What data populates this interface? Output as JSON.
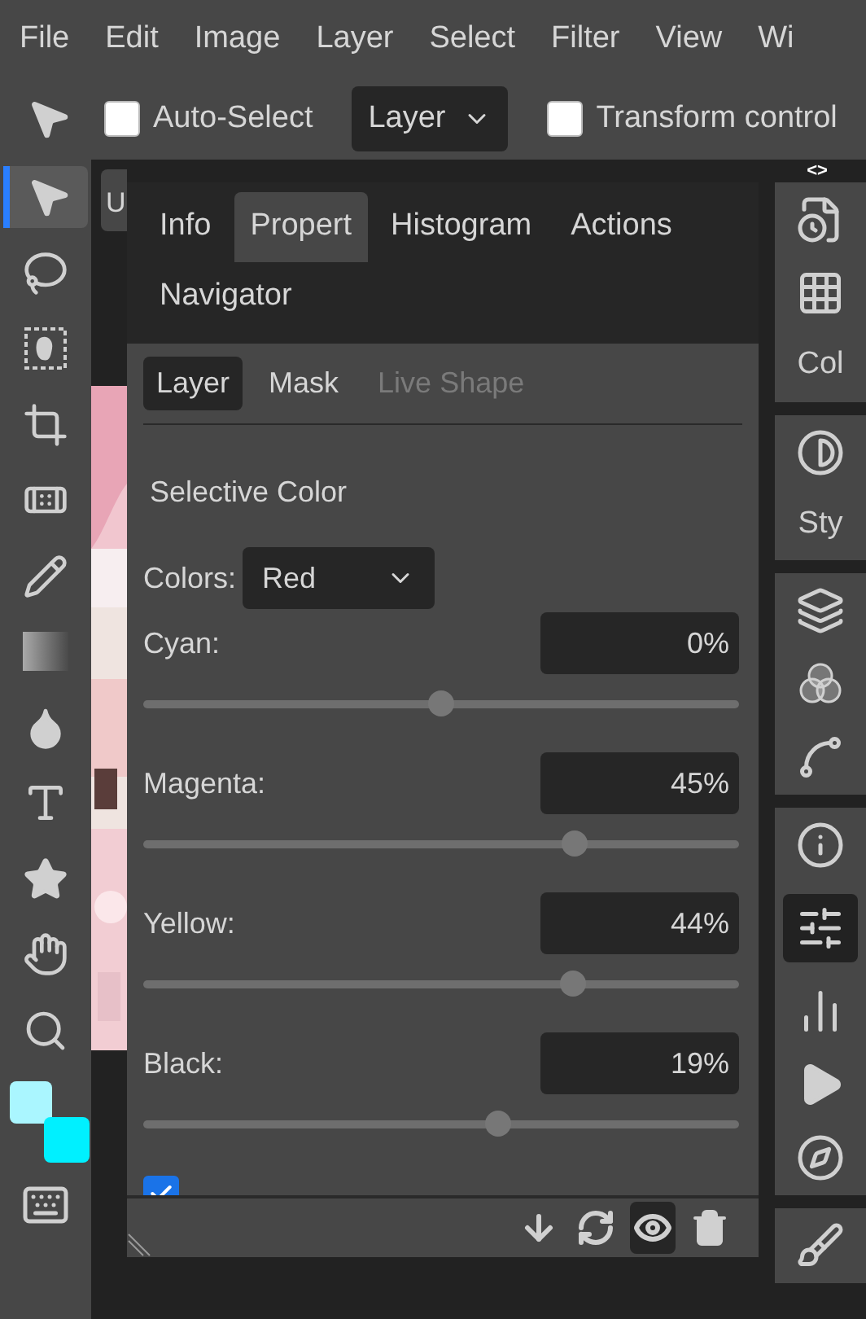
{
  "menu": [
    "File",
    "Edit",
    "Image",
    "Layer",
    "Select",
    "Filter",
    "View",
    "Wi"
  ],
  "toolbar": {
    "auto_select": {
      "label": "Auto-Select",
      "checked": false
    },
    "target": "Layer",
    "transform": {
      "label": "Transform control",
      "checked": false
    }
  },
  "tools": [
    {
      "kind": "move",
      "selected": true
    },
    {
      "kind": "lasso",
      "selected": false
    },
    {
      "kind": "quick-select",
      "selected": false
    },
    {
      "kind": "crop",
      "selected": false
    },
    {
      "kind": "heal",
      "selected": false
    },
    {
      "kind": "pencil",
      "selected": false
    },
    {
      "kind": "gradient",
      "selected": false
    },
    {
      "kind": "blur",
      "selected": false
    },
    {
      "kind": "type",
      "selected": false
    },
    {
      "kind": "shape",
      "selected": false
    },
    {
      "kind": "hand",
      "selected": false
    },
    {
      "kind": "zoom",
      "selected": false
    }
  ],
  "swatches": [
    {
      "color": "#aaf6ff"
    },
    {
      "color": "#00f0ff"
    }
  ],
  "document_tab": "U",
  "panel": {
    "tabs": [
      {
        "label": "Info",
        "selected": false
      },
      {
        "label": "Propert",
        "selected": true
      },
      {
        "label": "Histogram",
        "selected": false
      },
      {
        "label": "Actions",
        "selected": false
      },
      {
        "label": "Navigator",
        "selected": false
      }
    ],
    "sub_tabs": [
      {
        "label": "Layer",
        "selected": true,
        "disabled": false
      },
      {
        "label": "Mask",
        "selected": false,
        "disabled": false
      },
      {
        "label": "Live Shape",
        "selected": false,
        "disabled": true
      }
    ],
    "title": "Selective Color",
    "colors_label": "Colors:",
    "colors_value": "Red",
    "sliders": [
      {
        "label": "Cyan:",
        "value": "0%",
        "level": 0.5
      },
      {
        "label": "Magenta:",
        "value": "45%",
        "level": 0.725
      },
      {
        "label": "Yellow:",
        "value": "44%",
        "level": 0.72
      },
      {
        "label": "Black:",
        "value": "19%",
        "level": 0.595
      }
    ],
    "absolute": {
      "checked": true
    },
    "actions": [
      {
        "kind": "clip",
        "selected": false
      },
      {
        "kind": "reset",
        "selected": false
      },
      {
        "kind": "visibility",
        "selected": true
      },
      {
        "kind": "delete",
        "selected": false
      }
    ]
  },
  "dock": {
    "toggle": "<>",
    "groups": [
      [
        {
          "kind": "history"
        },
        {
          "kind": "swatches"
        },
        {
          "kind": "label",
          "label": "Col"
        }
      ],
      [
        {
          "kind": "adjust"
        },
        {
          "kind": "label",
          "label": "Sty"
        }
      ],
      [
        {
          "kind": "layers"
        },
        {
          "kind": "channels"
        },
        {
          "kind": "paths"
        }
      ],
      [
        {
          "kind": "info"
        },
        {
          "kind": "properties",
          "selected": true
        },
        {
          "kind": "histogram"
        },
        {
          "kind": "actions"
        },
        {
          "kind": "navigator"
        }
      ],
      [
        {
          "kind": "brush"
        }
      ]
    ]
  }
}
